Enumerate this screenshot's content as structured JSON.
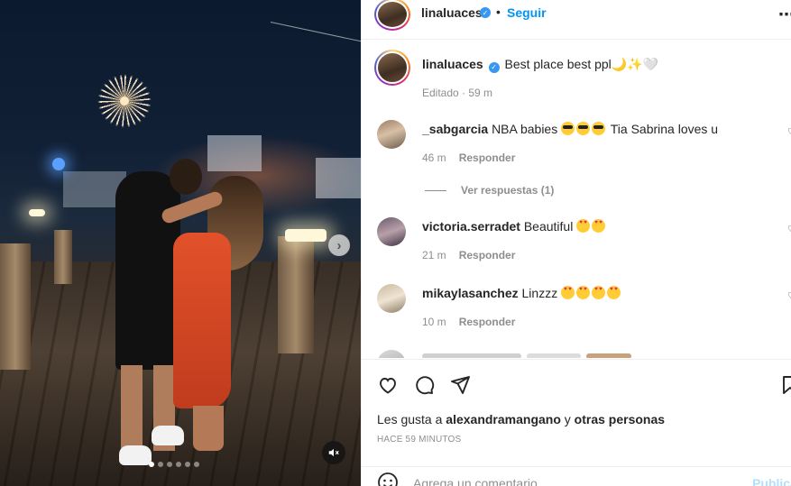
{
  "post": {
    "author": "linaluaces",
    "follow_label": "Seguir",
    "separator": "•",
    "more_label": "•••",
    "caption": "Best place best ppl🌙✨🤍",
    "caption_meta": "Editado · 59 m",
    "media": {
      "slide_count": 6,
      "active_slide": 1
    }
  },
  "comments": [
    {
      "username": "_sabgarcia",
      "text": "NBA babies",
      "text_after": "Tia Sabrina loves u",
      "emoji_kind": "cool",
      "emoji_count": 3,
      "time": "46 m",
      "reply_label": "Responder"
    },
    {
      "username": "victoria.serradet",
      "text": "Beautiful",
      "text_after": "",
      "emoji_kind": "heart-eyes",
      "emoji_count": 2,
      "time": "21 m",
      "reply_label": "Responder"
    },
    {
      "username": "mikaylasanchez",
      "text": "Linzzz",
      "text_after": "",
      "emoji_kind": "heart-eyes",
      "emoji_count": 4,
      "time": "10 m",
      "reply_label": "Responder"
    }
  ],
  "view_replies_label": "Ver respuestas (1)",
  "likes": {
    "prefix": "Les gusta a",
    "user": "alexandramangano",
    "joiner": "y",
    "others": "otras personas"
  },
  "time_ago": "HACE 59 MINUTOS",
  "add_comment": {
    "placeholder": "Agrega un comentario...",
    "publish_label": "Publicar"
  },
  "colors": {
    "link_blue": "#0095f6",
    "verified_blue": "#3897f0",
    "muted_text": "#8e8e8e",
    "publish_disabled": "#b2dffc"
  }
}
